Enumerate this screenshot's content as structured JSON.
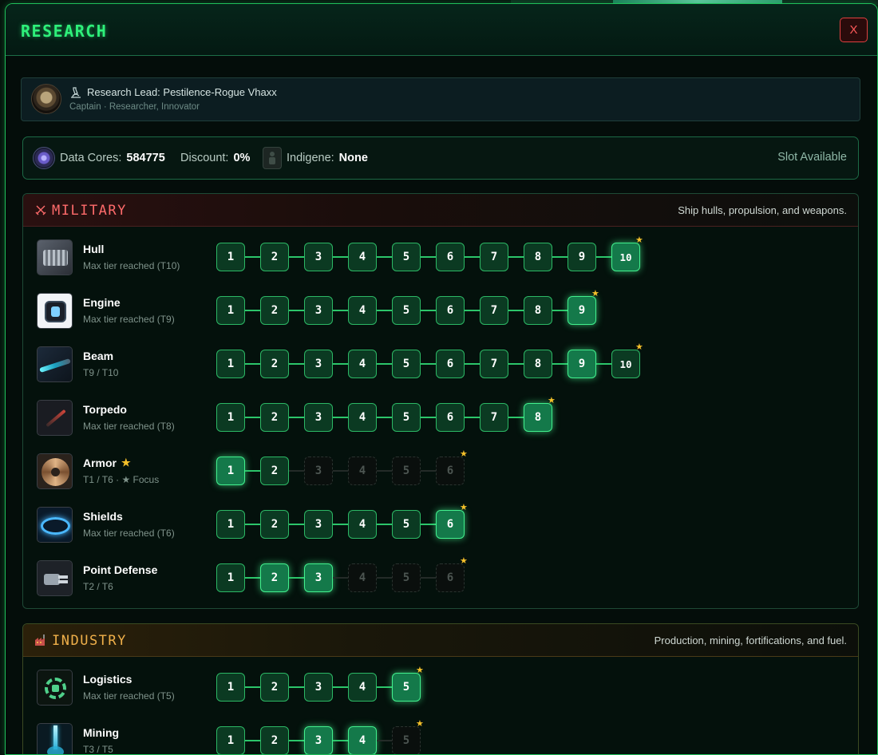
{
  "window": {
    "title": "RESEARCH",
    "close_label": "X"
  },
  "research_lead": {
    "label": "Research Lead: Pestilence-Rogue Vhaxx",
    "subtitle": "Captain · Researcher, Innovator"
  },
  "resources": {
    "data_cores_label": "Data Cores:",
    "data_cores_value": "584775",
    "discount_label": "Discount:",
    "discount_value": "0%",
    "indigene_label": "Indigene:",
    "indigene_value": "None",
    "slot_status": "Slot Available"
  },
  "sections": [
    {
      "title": "MILITARY",
      "description": "Ship hulls, propulsion, and weapons.",
      "accent": "#ff6b6b",
      "techs": [
        {
          "name": "Hull",
          "status": "Max tier reached (T10)",
          "icon": "hull-icon",
          "focus": false,
          "tiers": [
            "done",
            "done",
            "done",
            "done",
            "done",
            "done",
            "done",
            "done",
            "done",
            "active"
          ],
          "progress": "T10 / T10"
        },
        {
          "name": "Engine",
          "status": "Max tier reached (T9)",
          "icon": "engine-icon",
          "focus": false,
          "tiers": [
            "done",
            "done",
            "done",
            "done",
            "done",
            "done",
            "done",
            "done",
            "active"
          ],
          "progress": "T9 / T9"
        },
        {
          "name": "Beam",
          "status": "T9 / T10",
          "icon": "beam-icon",
          "focus": false,
          "tiers": [
            "done",
            "done",
            "done",
            "done",
            "done",
            "done",
            "done",
            "done",
            "active",
            "done"
          ],
          "progress": "T9 / T10"
        },
        {
          "name": "Torpedo",
          "status": "Max tier reached (T8)",
          "icon": "torpedo-icon",
          "focus": false,
          "tiers": [
            "done",
            "done",
            "done",
            "done",
            "done",
            "done",
            "done",
            "active"
          ],
          "progress": "T8 / T8"
        },
        {
          "name": "Armor",
          "status": "T1 / T6 · ★ Focus",
          "icon": "armor-icon",
          "focus": true,
          "tiers": [
            "active",
            "done",
            "locked",
            "locked",
            "locked",
            "locked"
          ],
          "progress": "T1 / T6"
        },
        {
          "name": "Shields",
          "status": "Max tier reached (T6)",
          "icon": "shields-icon",
          "focus": false,
          "tiers": [
            "done",
            "done",
            "done",
            "done",
            "done",
            "active"
          ],
          "progress": "T6 / T6"
        },
        {
          "name": "Point Defense",
          "status": "T2 / T6",
          "icon": "point-defense-icon",
          "focus": false,
          "tiers": [
            "done",
            "active",
            "active",
            "locked",
            "locked",
            "locked"
          ],
          "progress": "T2 / T6"
        }
      ]
    },
    {
      "title": "INDUSTRY",
      "description": "Production, mining, fortifications, and fuel.",
      "accent": "#f0b04a",
      "techs": [
        {
          "name": "Logistics",
          "status": "Max tier reached (T5)",
          "icon": "logistics-icon",
          "focus": false,
          "tiers": [
            "done",
            "done",
            "done",
            "done",
            "active"
          ],
          "progress": "T5 / T5"
        },
        {
          "name": "Mining",
          "status": "T3 / T5",
          "icon": "mining-icon",
          "focus": false,
          "tiers": [
            "done",
            "done",
            "active",
            "active",
            "locked"
          ],
          "progress": "T3 / T5"
        }
      ]
    }
  ],
  "tier_states": {
    "done": "researched",
    "active": "current / highlighted",
    "locked": "unavailable"
  },
  "colors": {
    "accent_green": "#2ef07a",
    "tier_done": "#0b3a22",
    "tier_active": "#14794a",
    "star": "#f5c02a",
    "close_red": "#e04040"
  }
}
